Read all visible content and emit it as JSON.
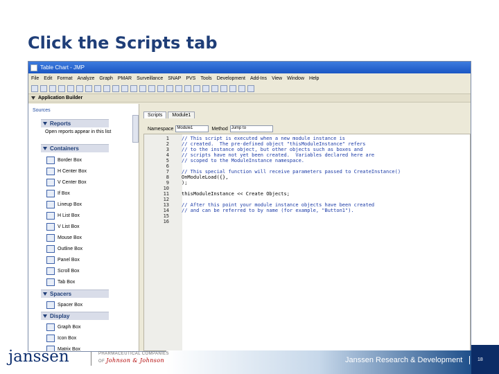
{
  "slide": {
    "title": "Click the Scripts tab"
  },
  "window": {
    "title": "Table Chart - JMP"
  },
  "menu": [
    "File",
    "Edit",
    "Format",
    "Analyze",
    "Graph",
    "PMAR",
    "Surveillance",
    "SNAP",
    "PVS",
    "Tools",
    "Development",
    "Add-Ins",
    "View",
    "Window",
    "Help"
  ],
  "builder": {
    "title": "Application Builder"
  },
  "panel": {
    "sources": "Sources",
    "reports_header": "Reports",
    "reports_note": "Open reports appear in this list",
    "containers_header": "Containers",
    "containers": [
      "Border Box",
      "H Center Box",
      "V Center Box",
      "If Box",
      "Lineup Box",
      "H List Box",
      "V List Box",
      "Mouse Box",
      "Outline Box",
      "Panel Box",
      "Scroll Box",
      "Tab Box"
    ],
    "spacers_header": "Spacers",
    "spacers": [
      "Spacer Box"
    ],
    "display_header": "Display",
    "display": [
      "Graph Box",
      "Icon Box",
      "Matrix Box"
    ]
  },
  "editor": {
    "tabs": [
      "Scripts",
      "Module1"
    ],
    "namespace_label": "Namespace",
    "namespace_value": "Module1",
    "method_label": "Method",
    "method_value": "Jump to",
    "lines": [
      {
        "n": "1",
        "t": "// This script is executed when a new module instance is",
        "c": true
      },
      {
        "n": "2",
        "t": "// created.  The pre-defined object \"thisModuleInstance\" refers",
        "c": true
      },
      {
        "n": "3",
        "t": "// to the instance object, but other objects such as boxes and",
        "c": true
      },
      {
        "n": "4",
        "t": "// scripts have not yet been created.  Variables declared here are",
        "c": true
      },
      {
        "n": "5",
        "t": "// scoped to the ModuleInstance namespace.",
        "c": true
      },
      {
        "n": "6",
        "t": "",
        "c": false
      },
      {
        "n": "7",
        "t": "// This special function will receive parameters passed to CreateInstance()",
        "c": true
      },
      {
        "n": "8",
        "t": "OnModuleLoad({},",
        "c": false
      },
      {
        "n": "9",
        "t": ");",
        "c": false
      },
      {
        "n": "10",
        "t": "",
        "c": false
      },
      {
        "n": "11",
        "t": "thisModuleInstance << Create Objects;",
        "c": false
      },
      {
        "n": "12",
        "t": "",
        "c": false
      },
      {
        "n": "13",
        "t": "// After this point your module instance objects have been created",
        "c": true
      },
      {
        "n": "14",
        "t": "// and can be referred to by name (for example, \"Button1\").",
        "c": true
      },
      {
        "n": "15",
        "t": "",
        "c": false
      },
      {
        "n": "16",
        "t": "",
        "c": false
      }
    ]
  },
  "footer": {
    "brand": "janssen",
    "pharma_line1": "PHARMACEUTICAL COMPANIES",
    "pharma_of": "OF",
    "pharma_jj": "Johnson & Johnson",
    "department": "Janssen Research & Development",
    "page_number": "18"
  }
}
